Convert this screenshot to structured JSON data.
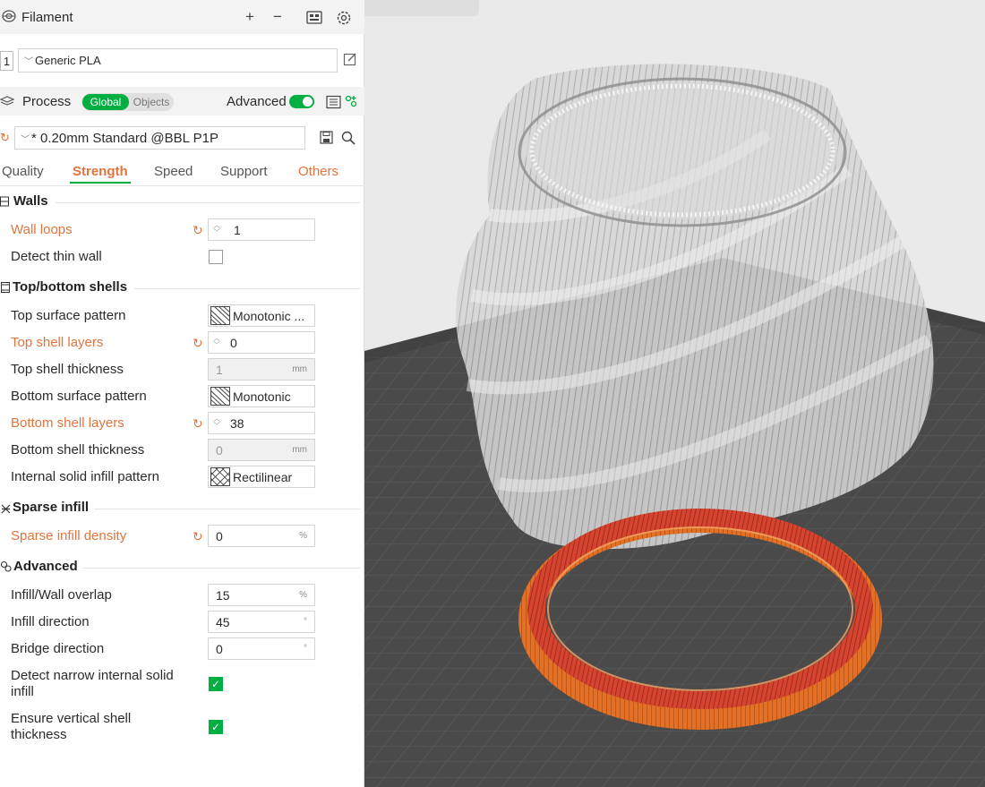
{
  "filament": {
    "title": "Filament",
    "slot_number": "1",
    "selected": "Generic PLA"
  },
  "process": {
    "title": "Process",
    "scope_global": "Global",
    "scope_objects": "Objects",
    "advanced_label": "Advanced",
    "preset": "* 0.20mm Standard @BBL P1P"
  },
  "tabs": [
    "Quality",
    "Strength",
    "Speed",
    "Support",
    "Others"
  ],
  "walls": {
    "title": "Walls",
    "wall_loops_label": "Wall loops",
    "wall_loops_value": "1",
    "detect_thin_wall_label": "Detect thin wall"
  },
  "shells": {
    "title": "Top/bottom shells",
    "top_surface_pattern_label": "Top surface pattern",
    "top_surface_pattern_value": "Monotonic ...",
    "top_shell_layers_label": "Top shell layers",
    "top_shell_layers_value": "0",
    "top_shell_thickness_label": "Top shell thickness",
    "top_shell_thickness_value": "1",
    "bottom_surface_pattern_label": "Bottom surface pattern",
    "bottom_surface_pattern_value": "Monotonic",
    "bottom_shell_layers_label": "Bottom shell layers",
    "bottom_shell_layers_value": "38",
    "bottom_shell_thickness_label": "Bottom shell thickness",
    "bottom_shell_thickness_value": "0",
    "internal_solid_infill_label": "Internal solid infill pattern",
    "internal_solid_infill_value": "Rectilinear",
    "unit_mm": "mm"
  },
  "sparse": {
    "title": "Sparse infill",
    "density_label": "Sparse infill density",
    "density_value": "0",
    "unit_pct": "%"
  },
  "advanced": {
    "title": "Advanced",
    "overlap_label": "Infill/Wall overlap",
    "overlap_value": "15",
    "infill_direction_label": "Infill direction",
    "infill_direction_value": "45",
    "bridge_direction_label": "Bridge direction",
    "bridge_direction_value": "0",
    "narrow_label": "Detect narrow internal solid infill",
    "vertical_label": "Ensure vertical shell thickness",
    "unit_pct": "%",
    "unit_deg": "°"
  },
  "colors": {
    "accent_green": "#00ae42",
    "accent_orange": "#e2743d",
    "plate": "#4a4a4a",
    "grid": "#5d5d5d"
  }
}
